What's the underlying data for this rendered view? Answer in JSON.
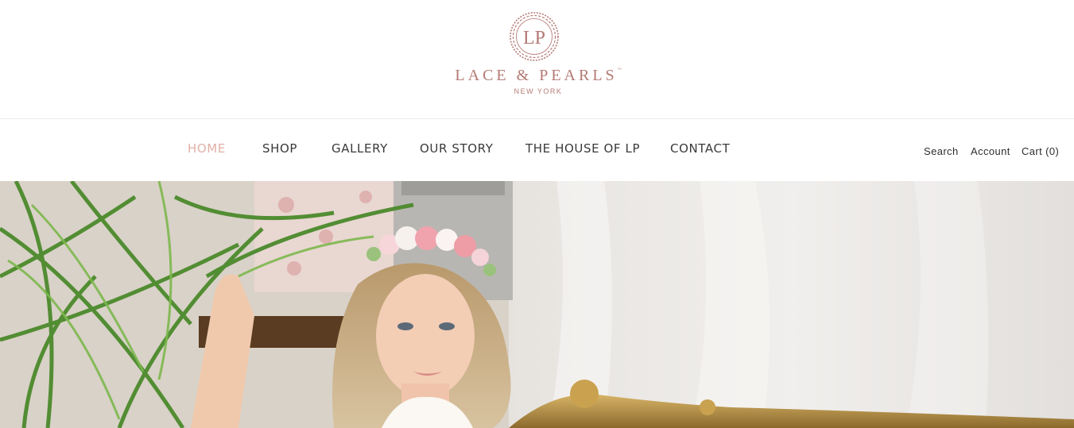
{
  "brand": {
    "monogram": "LP",
    "name": "LACE & PEARLS",
    "trademark": "™",
    "location": "NEW YORK",
    "color": "#b47a74"
  },
  "nav": {
    "items": [
      {
        "label": "HOME",
        "active": true
      },
      {
        "label": "SHOP",
        "active": false
      },
      {
        "label": "GALLERY",
        "active": false
      },
      {
        "label": "OUR STORY",
        "active": false
      },
      {
        "label": "THE HOUSE OF LP",
        "active": false
      },
      {
        "label": "CONTACT",
        "active": false
      }
    ],
    "active_color": "#e0b0a6",
    "text_color": "#3a3a3a"
  },
  "utility": {
    "search_label": "Search",
    "account_label": "Account",
    "cart_label": "Cart (0)"
  },
  "hero": {
    "image_name": "bride-with-flower-crown-hero"
  }
}
